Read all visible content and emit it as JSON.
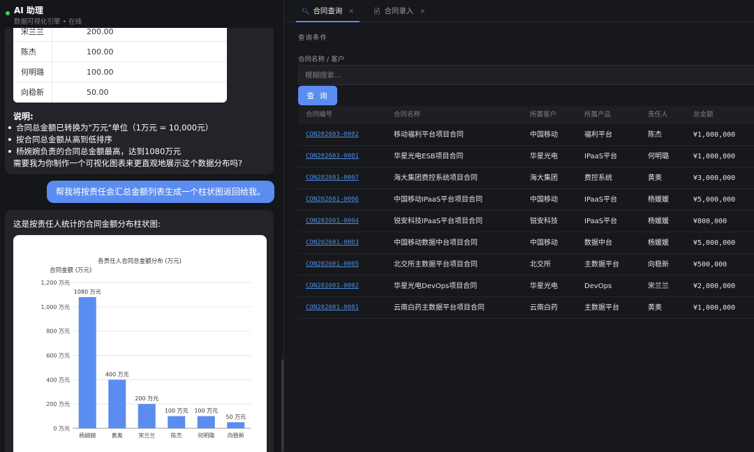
{
  "assistant": {
    "title": "AI 助理",
    "subtitle": "数据可视化引擎 • 在线"
  },
  "first_reply": {
    "table_rows": [
      {
        "name": "宋兰兰",
        "amount": "200.00"
      },
      {
        "name": "陈杰",
        "amount": "100.00"
      },
      {
        "name": "何明璐",
        "amount": "100.00"
      },
      {
        "name": "向稳新",
        "amount": "50.00"
      }
    ],
    "explain_title": "说明:",
    "bullets": [
      "合同总金额已转换为\"万元\"单位（1万元 = 10,000元）",
      "按合同总金额从高到低排序",
      "杨婉婉负责的合同总金额最高，达到1080万元"
    ],
    "followup": "需要我为你制作一个可视化图表来更直观地展示这个数据分布吗?"
  },
  "user_message": "帮我将按责任会汇总金额列表生成一个柱状图返回给我。",
  "second_reply": {
    "intro": "这是按责任人统计的合同金额分布柱状图:"
  },
  "chart_data": {
    "type": "bar",
    "title": "各责任人合同总金额分布 (万元)",
    "ylabel": "合同金额 (万元)",
    "xlabel": "",
    "categories": [
      "杨婉婉",
      "黄奥",
      "宋兰兰",
      "陈杰",
      "何明璐",
      "向稳新"
    ],
    "values": [
      1080,
      400,
      200,
      100,
      100,
      50
    ],
    "data_labels": [
      "1080 万元",
      "400 万元",
      "200 万元",
      "100 万元",
      "100 万元",
      "50 万元"
    ],
    "yticks": [
      "0 万元",
      "200 万元",
      "400 万元",
      "600 万元",
      "800 万元",
      "1,000 万元",
      "1,200 万元"
    ],
    "ylim": [
      0,
      1200
    ],
    "bar_color": "#5b8cf0",
    "grid": true
  },
  "tabs": [
    {
      "label": "合同查询",
      "icon": "search-icon",
      "active": true
    },
    {
      "label": "合同录入",
      "icon": "document-icon",
      "active": false
    }
  ],
  "query": {
    "section_title": "查询条件",
    "field_label": "合同名称 / 客户",
    "placeholder": "模糊搜索...",
    "button_label": "查 询"
  },
  "grid": {
    "columns": [
      "合同编号",
      "合同名称",
      "所属客户",
      "所属产品",
      "责任人",
      "总金额"
    ],
    "rows": [
      [
        "CON202603-0002",
        "移动福利平台项目合同",
        "中国移动",
        "福利平台",
        "陈杰",
        "¥1,000,000"
      ],
      [
        "CON202603-0001",
        "华星光电ESB项目合同",
        "华星光电",
        "IPaaS平台",
        "何明璐",
        "¥1,000,000"
      ],
      [
        "CON202601-0007",
        "海大集团费控系统项目合同",
        "海大集团",
        "费控系统",
        "黄奥",
        "¥3,000,000"
      ],
      [
        "CON202601-0006",
        "中国移动IPaaS平台项目合同",
        "中国移动",
        "IPaaS平台",
        "杨媛媛",
        "¥5,000,000"
      ],
      [
        "CON202601-0004",
        "锐安科技IPaaS平台项目合同",
        "锐安科技",
        "IPaaS平台",
        "杨媛媛",
        "¥800,000"
      ],
      [
        "CON202601-0003",
        "中国移动数据中台项目合同",
        "中国移动",
        "数据中台",
        "杨媛媛",
        "¥5,000,000"
      ],
      [
        "CON202601-0005",
        "北交所主数据平台项目合同",
        "北交所",
        "主数据平台",
        "向稳新",
        "¥500,000"
      ],
      [
        "CON202601-0002",
        "华星光电DevOps项目合同",
        "华星光电",
        "DevOps",
        "宋兰兰",
        "¥2,000,000"
      ],
      [
        "CON202601-0001",
        "云南白药主数据平台项目合同",
        "云南白药",
        "主数据平台",
        "黄奥",
        "¥1,000,000"
      ]
    ]
  }
}
